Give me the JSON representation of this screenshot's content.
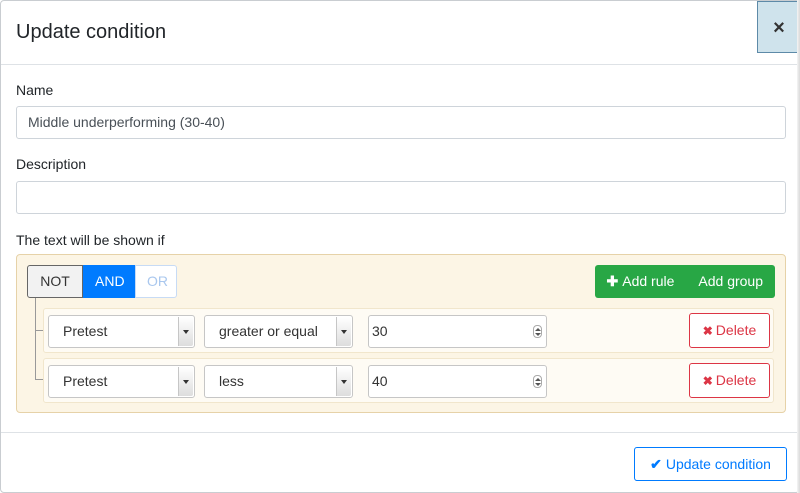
{
  "modal": {
    "title": "Update condition",
    "close_glyph": "×"
  },
  "form": {
    "name_label": "Name",
    "name_value": "Middle underperforming (30-40)",
    "description_label": "Description",
    "description_value": "",
    "condition_label": "The text will be shown if"
  },
  "query_builder": {
    "conditions": [
      "NOT",
      "AND",
      "OR"
    ],
    "active_condition": "AND",
    "add_rule_label": "Add rule",
    "add_group_label": "Add group",
    "rules": [
      {
        "field": "Pretest",
        "operator": "greater or equal",
        "value": "30",
        "delete_label": "Delete"
      },
      {
        "field": "Pretest",
        "operator": "less",
        "value": "40",
        "delete_label": "Delete"
      }
    ]
  },
  "footer": {
    "update_label": "Update condition"
  },
  "icons": {
    "plus": "plus-icon",
    "times": "times-icon",
    "check": "check-icon"
  },
  "colors": {
    "primary": "#007bff",
    "success": "#28a745",
    "danger": "#dc3545",
    "group_bg": "#fcf5e5"
  }
}
